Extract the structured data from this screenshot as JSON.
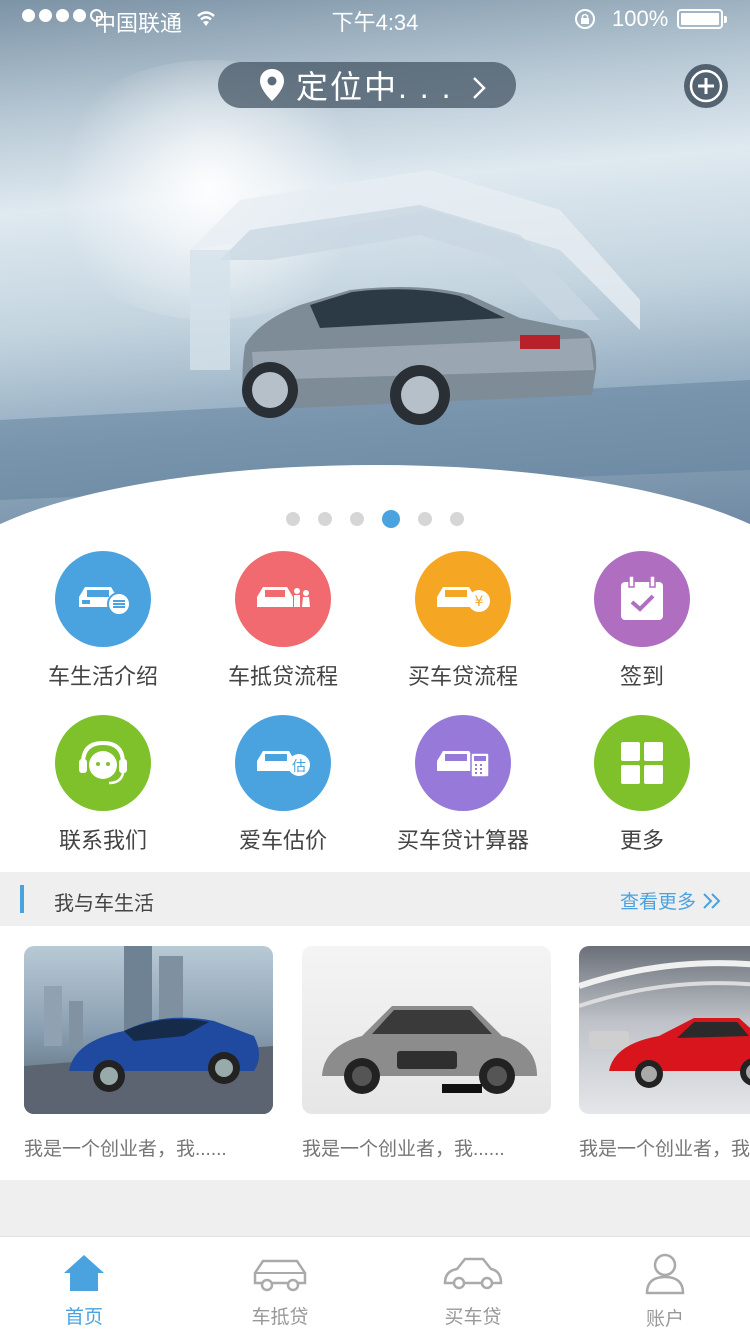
{
  "status_bar": {
    "carrier": "中国联通",
    "time": "下午4:34",
    "battery": "100%"
  },
  "header": {
    "location_label": "定位中. . ."
  },
  "banner": {
    "page_count": 6,
    "active_page_index": 3
  },
  "services": [
    {
      "label": "车生活介绍",
      "icon": "car-list-icon",
      "color": "#4aa3df"
    },
    {
      "label": "车抵贷流程",
      "icon": "car-people-icon",
      "color": "#f06a6f"
    },
    {
      "label": "买车贷流程",
      "icon": "car-yuan-icon",
      "color": "#f5a623"
    },
    {
      "label": "签到",
      "icon": "calendar-check-icon",
      "color": "#b06ec1"
    },
    {
      "label": "联系我们",
      "icon": "headset-icon",
      "color": "#7ec12b"
    },
    {
      "label": "爱车估价",
      "icon": "car-estimate-icon",
      "color": "#4aa3df"
    },
    {
      "label": "买车贷计算器",
      "icon": "car-calculator-icon",
      "color": "#9679d9"
    },
    {
      "label": "更多",
      "icon": "grid-icon",
      "color": "#7ec12b"
    }
  ],
  "section": {
    "title": "我与车生活",
    "more_label": "查看更多"
  },
  "cards": [
    {
      "caption": "我是一个创业者，我......"
    },
    {
      "caption": "我是一个创业者，我......"
    },
    {
      "caption": "我是一个创业者，我......"
    }
  ],
  "tabs": [
    {
      "label": "首页",
      "icon": "home-icon"
    },
    {
      "label": "车抵贷",
      "icon": "car-icon"
    },
    {
      "label": "买车贷",
      "icon": "car-outline-icon"
    },
    {
      "label": "账户",
      "icon": "user-icon"
    }
  ]
}
